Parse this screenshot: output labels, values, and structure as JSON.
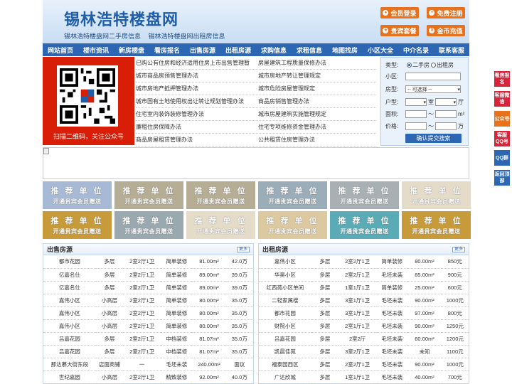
{
  "header": {
    "logo_text": "锡林浩特楼盘网",
    "sub_links": [
      "锡林浩特楼盘网二手房信息",
      "锡林浩特楼盘网出租房信息"
    ],
    "buttons": [
      {
        "label": "会员登录",
        "icon": "user-icon"
      },
      {
        "label": "免费注册",
        "icon": "register-icon"
      },
      {
        "label": "贵宾套餐",
        "icon": "vip-icon"
      },
      {
        "label": "金币充值",
        "icon": "coin-icon"
      }
    ]
  },
  "nav": [
    "网站首页",
    "楼市资讯",
    "新房楼盘",
    "看房报名",
    "出售房源",
    "出租房源",
    "求购信息",
    "求租信息",
    "地图找房",
    "小区大全",
    "中介名录",
    "联系客服"
  ],
  "qr": {
    "caption": "扫描二维码，关注公众号"
  },
  "links": [
    [
      "已购公有住房和经济适用住房上市出售管理暂",
      "房屋建筑工程质量保修办法"
    ],
    [
      "城市商品房预售管理办法",
      "城市房地产转让管理规定"
    ],
    [
      "城市房地产抵押管理办法",
      "城市危险房屋管理规定"
    ],
    [
      "城市国有土地使用权出让转让规划管理办法",
      "商品房销售管理办法"
    ],
    [
      "住宅室内装饰装修管理办法",
      "城市房屋建筑实施管理规定"
    ],
    [
      "廉租住房保障办法",
      "住宅专项维修资金管理办法"
    ],
    [
      "商品房屋租赁管理办法",
      "公共租赁住房管理办法"
    ]
  ],
  "search": {
    "type_label": "类型:",
    "type_options": [
      "二手房",
      "出租房"
    ],
    "type_selected": "二手房",
    "community_label": "小区:",
    "style_label": "房型:",
    "style_selected": "-- 可选择 --",
    "layout_label": "户型:",
    "room_unit": "室",
    "hall_unit": "厅",
    "area_label": "面积:",
    "area_unit": "m²",
    "price_label": "价格:",
    "price_unit": "万",
    "range_sep": "〜",
    "submit_label": "确认提交搜索"
  },
  "recommend": {
    "title": "推 荐 单 位",
    "subtitle": "开通贵宾会员赠送",
    "colors": [
      "#a7b9d4",
      "#b5ad94",
      "#b5ad94",
      "#9aadb8",
      "#a8b0b4",
      "#e4dcc8",
      "#c79b3a",
      "#9aa8b0",
      "#e4dcc8",
      "#dcc9a0",
      "#5aabb5",
      "#c79b3a"
    ]
  },
  "sale": {
    "title": "出售房源",
    "more": "更多",
    "rows": [
      [
        "都市花园",
        "多层",
        "2室2厅1卫",
        "简单装修",
        "81.00m²",
        "42.0万"
      ],
      [
        "亿嘉名仕",
        "多层",
        "2室2厅1卫",
        "简单装修",
        "89.00m²",
        "39.0万"
      ],
      [
        "亿嘉名仕",
        "多层",
        "2室2厅1卫",
        "简单装修",
        "89.00m²",
        "39.0万"
      ],
      [
        "嘉伟小区",
        "小高层",
        "2室2厅1卫",
        "简单装修",
        "80.00m²",
        "35.0万"
      ],
      [
        "嘉伟小区",
        "小高层",
        "2室2厅1卫",
        "简单装修",
        "80.00m²",
        "35.0万"
      ],
      [
        "嘉伟小区",
        "小高层",
        "2室2厅1卫",
        "简单装修",
        "80.00m²",
        "35.0万"
      ],
      [
        "吕嘉花园",
        "多层",
        "2室2厅1卫",
        "中档装修",
        "81.07m²",
        "35.0万"
      ],
      [
        "吕嘉花园",
        "多层",
        "2室2厅1卫",
        "中档装修",
        "81.07m²",
        "35.0万"
      ],
      [
        "那达慕大街东段",
        "店面商铺",
        "一",
        "毛坯未装",
        "240.00m²",
        "面议"
      ],
      [
        "世纪嘉园",
        "小高层",
        "2室2厅1卫",
        "精致装修",
        "92.00m²",
        "40.0万"
      ]
    ]
  },
  "rent": {
    "title": "出租房源",
    "more": "更多",
    "rows": [
      [
        "嘉伟小区",
        "多层",
        "2室2厅1卫",
        "简单装修",
        "80.00m²",
        "850元"
      ],
      [
        "华昊小区",
        "多层",
        "2室2厅1卫",
        "毛坯未装",
        "85.00m²",
        "900元"
      ],
      [
        "红西苑小区单间",
        "多层",
        "1室1厅1卫",
        "简单装修",
        "25.00m²",
        "600元"
      ],
      [
        "二轻家属楼",
        "多层",
        "3室1厅1卫",
        "毛坯未装",
        "90.00m²",
        "1000元"
      ],
      [
        "都市花园",
        "多层",
        "3室1厅1卫",
        "毛坯未装",
        "97.00m²",
        "800元"
      ],
      [
        "财院小区",
        "多层",
        "2室1厅1卫",
        "毛坯未装",
        "90.00m²",
        "1250元"
      ],
      [
        "吕嘉花园",
        "多层",
        "2室2厅",
        "毛坯未装",
        "60.00m²",
        "1200元"
      ],
      [
        "凯晨佳苑",
        "多层",
        "3室2厅1卫",
        "毛坯未装",
        "未知",
        "1100元"
      ],
      [
        "福泰园西区",
        "多层",
        "2室2厅1卫",
        "毛坯未装",
        "90.00m²",
        "1000元"
      ],
      [
        "广达欣城",
        "多层",
        "1室1厅1卫",
        "毛坯未装",
        "40.00m²",
        "700元"
      ]
    ]
  },
  "float_buttons": [
    {
      "label": "看房报名",
      "color": "#d8243b"
    },
    {
      "label": "客服微信",
      "color": "#d8243b"
    },
    {
      "label": "公众号",
      "color": "#e8711e"
    },
    {
      "label": "客服QQ号",
      "color": "#d8243b"
    },
    {
      "label": "QQ群",
      "color": "#2d67b3"
    },
    {
      "label": "返回顶部",
      "color": "#2d67b3"
    }
  ]
}
